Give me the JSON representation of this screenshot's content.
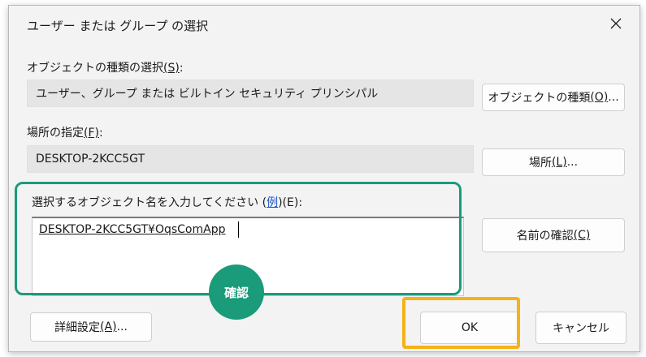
{
  "window": {
    "title": "ユーザー または グループ の選択"
  },
  "object_type": {
    "label_text": "オブジェクトの種類の選択",
    "label_key": "(S)",
    "value": "ユーザー、グループ または ビルトイン セキュリティ プリンシパル",
    "button_text": "オブジェクトの種類",
    "button_key": "(O)",
    "button_suffix": "..."
  },
  "location": {
    "label_text": "場所の指定",
    "label_key": "(F)",
    "label_suffix": ":",
    "value": "DESKTOP-2KCC5GT",
    "button_text": "場所",
    "button_key": "(L)",
    "button_suffix": "..."
  },
  "object_names": {
    "label_text": "選択するオブジェクト名を入力してください (",
    "example_link": "例",
    "label_key": ")(E)",
    "label_suffix": ":",
    "value": "DESKTOP-2KCC5GT¥OqsComApp",
    "check_button_text": "名前の確認",
    "check_button_key": "(C)"
  },
  "annotation": {
    "badge_text": "確認",
    "green_color": "#1a9b7a",
    "orange_color": "#f5b21b"
  },
  "footer": {
    "advanced_text": "詳細設定",
    "advanced_key": "(A)",
    "advanced_suffix": "...",
    "ok_label": "OK",
    "cancel_label": "キャンセル"
  }
}
